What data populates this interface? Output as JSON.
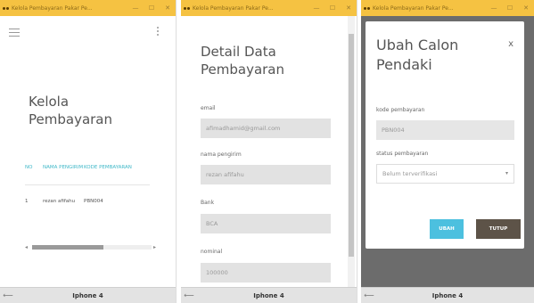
{
  "phone1": {
    "window_title": "Kelola Pembayaran Pakar Pe...",
    "page_title": "Kelola Pembayaran",
    "table": {
      "headers": [
        "NO",
        "NAMA PENGIRIM",
        "KODE PEMBAYARAN"
      ],
      "rows": [
        [
          "1",
          "rezan afifahu",
          "PBN004"
        ]
      ]
    },
    "device": "Iphone 4"
  },
  "phone2": {
    "window_title": "Kelola Pembayaran Pakar Pe...",
    "page_title": "Detail Data Pembayaran",
    "fields": [
      {
        "label": "email",
        "value": "afimadhamid@gmail.com"
      },
      {
        "label": "nama pengirim",
        "value": "rezan afifahu"
      },
      {
        "label": "Bank",
        "value": "BCA"
      },
      {
        "label": "nominal",
        "value": "100000"
      }
    ],
    "device": "Iphone 4"
  },
  "phone3": {
    "window_title": "Kelola Pembayaran Pakar Pe...",
    "modal_title": "Ubah Calon Pendaki",
    "close_label": "x",
    "kode_label": "kode pembayaran",
    "kode_value": "PBN004",
    "status_label": "status pembayaran",
    "status_value": "Belum terverifikasi",
    "ubah_label": "UBAH",
    "tutup_label": "TUTUP",
    "device": "Iphone 4"
  },
  "window_controls": {
    "minimize": "—",
    "maximize": "☐",
    "close": "✕"
  },
  "icons": {
    "back": "arrow-left-icon",
    "menu": "hamburger-icon",
    "more": "kebab-icon",
    "app": "app-logo-icon"
  },
  "colors": {
    "titlebar": "#f5c242",
    "table_header": "#3fb8c8",
    "ubah_button": "#4cc0df",
    "tutup_button": "#5d5348"
  }
}
